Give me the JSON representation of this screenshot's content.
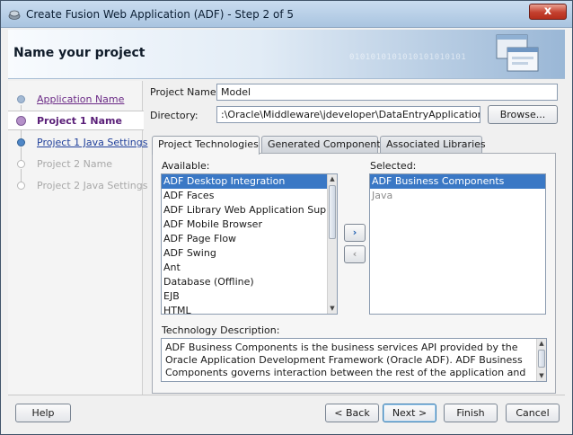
{
  "window": {
    "title": "Create Fusion Web Application (ADF) - Step 2 of 5",
    "close_label": "x"
  },
  "header": {
    "page_title": "Name your project",
    "binary_text": "0101010101010101010101\n   010101010"
  },
  "nav": {
    "items": [
      {
        "label": "Application Name",
        "state": "visited"
      },
      {
        "label": "Project 1 Name",
        "state": "current"
      },
      {
        "label": "Project 1 Java Settings",
        "state": "link"
      },
      {
        "label": "Project 2 Name",
        "state": "disabled"
      },
      {
        "label": "Project 2 Java Settings",
        "state": "disabled"
      }
    ]
  },
  "form": {
    "project_name_label": "Project Name:",
    "project_name_value": "Model",
    "directory_label": "Directory:",
    "directory_value": ":\\Oracle\\Middleware\\jdeveloper\\DataEntryApplication\\Model",
    "browse_label": "Browse..."
  },
  "tabs": [
    {
      "label": "Project Technologies",
      "active": true
    },
    {
      "label": "Generated Components",
      "active": false
    },
    {
      "label": "Associated Libraries",
      "active": false
    }
  ],
  "available": {
    "label": "Available:",
    "items": [
      "ADF Desktop Integration",
      "ADF Faces",
      "ADF Library Web Application Support",
      "ADF Mobile Browser",
      "ADF Page Flow",
      "ADF Swing",
      "Ant",
      "Database (Offline)",
      "EJB",
      "HTML"
    ],
    "selected_index": 0
  },
  "selected": {
    "label": "Selected:",
    "items": [
      "ADF Business Components",
      "Java"
    ],
    "selected_index": 0
  },
  "move_buttons": {
    "add": "›",
    "remove": "‹"
  },
  "description": {
    "label": "Technology Description:",
    "text": "ADF Business Components is the business services API provided by the Oracle Application Development Framework (Oracle ADF).  ADF Business Components governs interaction between the rest of the application and the data stored in the"
  },
  "footer": {
    "help": "Help",
    "back": "< Back",
    "next": "Next >",
    "finish": "Finish",
    "cancel": "Cancel"
  },
  "colors": {
    "selection": "#3a78c5",
    "visited_link": "#6b2a86",
    "link": "#1f3f9a",
    "current_step": "#5a1f78"
  }
}
